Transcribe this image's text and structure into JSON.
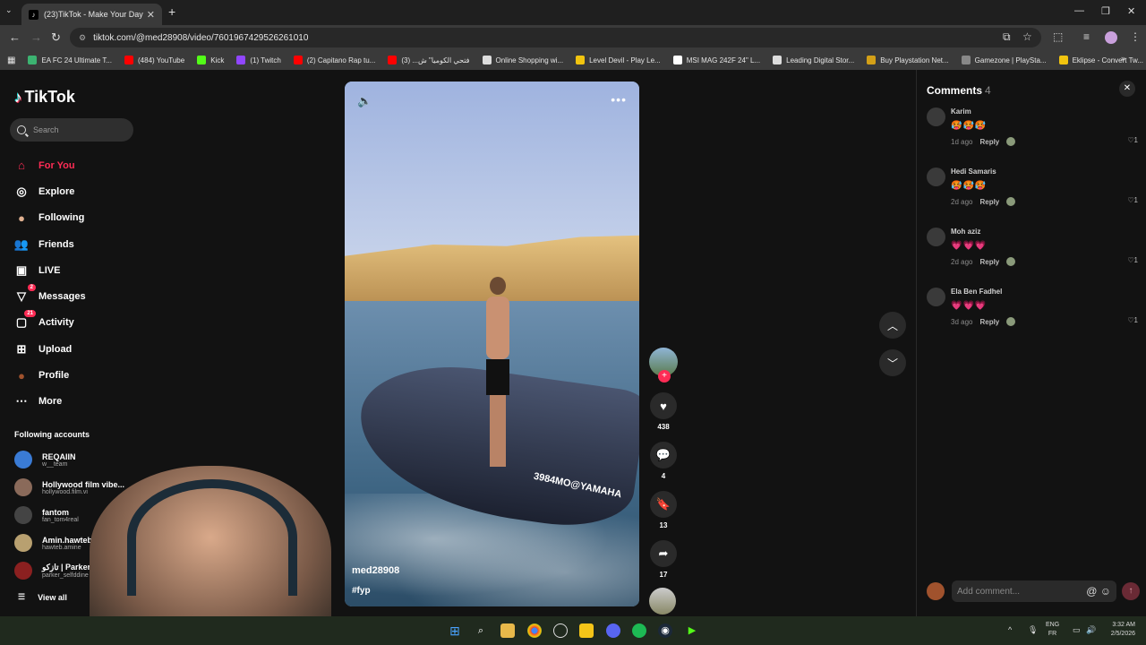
{
  "browser": {
    "tab_title": "(23)TikTok - Make Your Day",
    "url": "tiktok.com/@med28908/video/7601967429526261010",
    "bookmarks": [
      {
        "label": "EA FC 24 Ultimate T...",
        "color": "#3cb371"
      },
      {
        "label": "(484) YouTube",
        "color": "#ff0000"
      },
      {
        "label": "Kick",
        "color": "#53fc18"
      },
      {
        "label": "(1) Twitch",
        "color": "#9146ff"
      },
      {
        "label": "(2) Capitano Rap tu...",
        "color": "#ff0000"
      },
      {
        "label": "فتحي الكوميا\" ش... (3)",
        "color": "#ff0000"
      },
      {
        "label": "Online Shopping wi...",
        "color": "#dddddd"
      },
      {
        "label": "Level Devil - Play Le...",
        "color": "#f1c40f"
      },
      {
        "label": "MSI MAG 242F 24\" L...",
        "color": "#ffffff"
      },
      {
        "label": "Leading Digital Stor...",
        "color": "#dddddd"
      },
      {
        "label": "Buy Playstation Net...",
        "color": "#d4a017"
      },
      {
        "label": "Gamezone | PlaySta...",
        "color": "#888888"
      },
      {
        "label": "Eklipse - Convert Tw...",
        "color": "#f1c40f"
      }
    ]
  },
  "sidebar": {
    "logo": "TikTok",
    "search_placeholder": "Search",
    "nav": [
      {
        "label": "For You",
        "icon": "home-icon",
        "active": true
      },
      {
        "label": "Explore",
        "icon": "compass-icon"
      },
      {
        "label": "Following",
        "icon": "following-avatar-icon"
      },
      {
        "label": "Friends",
        "icon": "friends-icon"
      },
      {
        "label": "LIVE",
        "icon": "live-icon"
      },
      {
        "label": "Messages",
        "icon": "messages-icon",
        "badge": "2"
      },
      {
        "label": "Activity",
        "icon": "activity-icon",
        "badge": "21"
      },
      {
        "label": "Upload",
        "icon": "upload-icon"
      },
      {
        "label": "Profile",
        "icon": "profile-avatar-icon"
      },
      {
        "label": "More",
        "icon": "more-icon"
      }
    ],
    "following_header": "Following accounts",
    "following": [
      {
        "name": "REQAIIN",
        "handle": "w__team",
        "color": "#3a7bd5"
      },
      {
        "name": "Hollywood film vibe...",
        "handle": "hollywood.film.vi",
        "color": "#8a6a5a"
      },
      {
        "name": "fantom",
        "handle": "fan_tom4real",
        "color": "#444444"
      },
      {
        "name": "Amin.hawtebᵀᴺ",
        "handle": "hawteb.amine",
        "color": "#b8a070"
      },
      {
        "name": "تازكو | Parker",
        "handle": "parker_selfddine",
        "color": "#8b2020"
      }
    ],
    "view_all": "View all"
  },
  "video": {
    "author": "med28908",
    "hashtag": "#fyp",
    "jetski_text": "3984MO@YAMAHA",
    "likes": "438",
    "comments": "4",
    "saves": "13",
    "shares": "17"
  },
  "comments": {
    "title": "Comments",
    "count": "4",
    "items": [
      {
        "user": "Karim",
        "text": "🥵🥵🥵",
        "time": "1d ago",
        "reply": "Reply",
        "likes": "1"
      },
      {
        "user": "Hedi Samaris",
        "text": "🥵🥵🥵",
        "time": "2d ago",
        "reply": "Reply",
        "likes": "1"
      },
      {
        "user": "Moh aziz",
        "text": "💗💗💗",
        "time": "2d ago",
        "reply": "Reply",
        "likes": "1"
      },
      {
        "user": "Ela Ben Fadhel",
        "text": "💗💗💗",
        "time": "3d ago",
        "reply": "Reply",
        "likes": "1"
      }
    ],
    "add_placeholder": "Add comment..."
  },
  "taskbar": {
    "lang_top": "ENG",
    "lang_bottom": "FR",
    "time": "3:32 AM",
    "date": "2/5/2026"
  }
}
